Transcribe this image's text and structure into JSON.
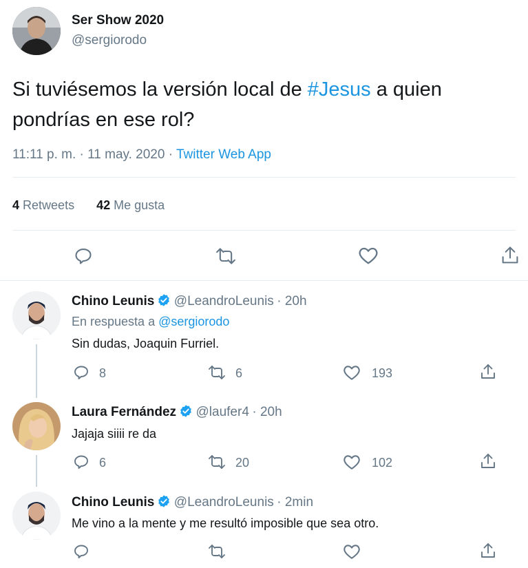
{
  "main_tweet": {
    "author_name": "Ser Show 2020",
    "author_handle": "@sergiorodo",
    "text_before": "Si tuviésemos la versión local de ",
    "hashtag": "#Jesus",
    "text_after_line1": " a quien",
    "text_line2": "pondrías en  ese rol?",
    "timestamp": "11:11 p. m. · 11 may. 2020 · ",
    "source": "Twitter Web App",
    "retweets_count": "4",
    "retweets_label": "Retweets",
    "likes_count": "42",
    "likes_label": "Me gusta"
  },
  "replies": [
    {
      "author_name": "Chino Leunis",
      "author_handle": "@LeandroLeunis",
      "time": "· 20h",
      "reply_to_prefix": "En respuesta a ",
      "reply_to_handle": "@sergiorodo",
      "text": "Sin dudas, Joaquin Furriel.",
      "replies_count": "8",
      "retweets_count": "6",
      "likes_count": "193"
    },
    {
      "author_name": "Laura Fernández",
      "author_handle": "@laufer4",
      "time": "· 20h",
      "text": "Jajaja siiii re da",
      "replies_count": "6",
      "retweets_count": "20",
      "likes_count": "102"
    },
    {
      "author_name": "Chino Leunis",
      "author_handle": "@LeandroLeunis",
      "time": "· 2min",
      "text": "Me vino a la mente y me resultó imposible que sea otro."
    }
  ],
  "colors": {
    "link": "#1b95e0",
    "muted": "#657786",
    "verified": "#1da1f2",
    "divider": "#e6ecf0"
  },
  "icons": [
    "reply-icon",
    "retweet-icon",
    "like-icon",
    "share-icon",
    "verified-icon"
  ]
}
